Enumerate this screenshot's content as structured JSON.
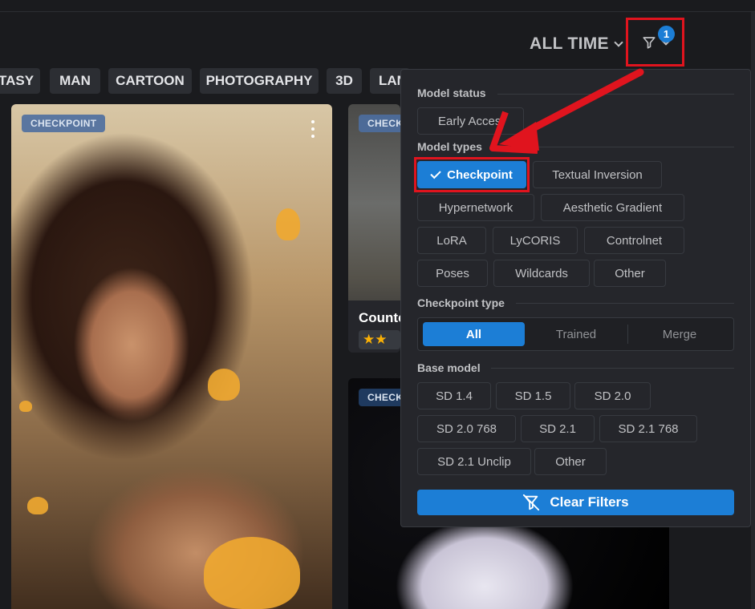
{
  "header": {
    "sort_label": "ALL TIME",
    "filter_count": "1"
  },
  "tags": [
    "TASY",
    "MAN",
    "CARTOON",
    "PHOTOGRAPHY",
    "3D",
    "LAN"
  ],
  "cards": [
    {
      "badge": "CHECKPOINT"
    },
    {
      "badge": "CHECK",
      "title": "Counte",
      "stars": "★★"
    },
    {
      "badge": "CHECK"
    }
  ],
  "filter_panel": {
    "model_status": {
      "label": "Model status",
      "options": [
        "Early Acces"
      ]
    },
    "model_types": {
      "label": "Model types",
      "options": [
        "Checkpoint",
        "Textual Inversion",
        "Hypernetwork",
        "Aesthetic Gradient",
        "LoRA",
        "LyCORIS",
        "Controlnet",
        "Poses",
        "Wildcards",
        "Other"
      ],
      "selected": "Checkpoint"
    },
    "checkpoint_type": {
      "label": "Checkpoint type",
      "options": [
        "All",
        "Trained",
        "Merge"
      ],
      "selected": "All"
    },
    "base_model": {
      "label": "Base model",
      "options": [
        "SD 1.4",
        "SD 1.5",
        "SD 2.0",
        "SD 2.0 768",
        "SD 2.1",
        "SD 2.1 768",
        "SD 2.1 Unclip",
        "Other"
      ]
    },
    "clear_label": "Clear Filters"
  },
  "colors": {
    "accent": "#1c7ed6",
    "annotation": "#e0141e",
    "panel_bg": "#25262b",
    "page_bg": "#1a1b1e"
  }
}
